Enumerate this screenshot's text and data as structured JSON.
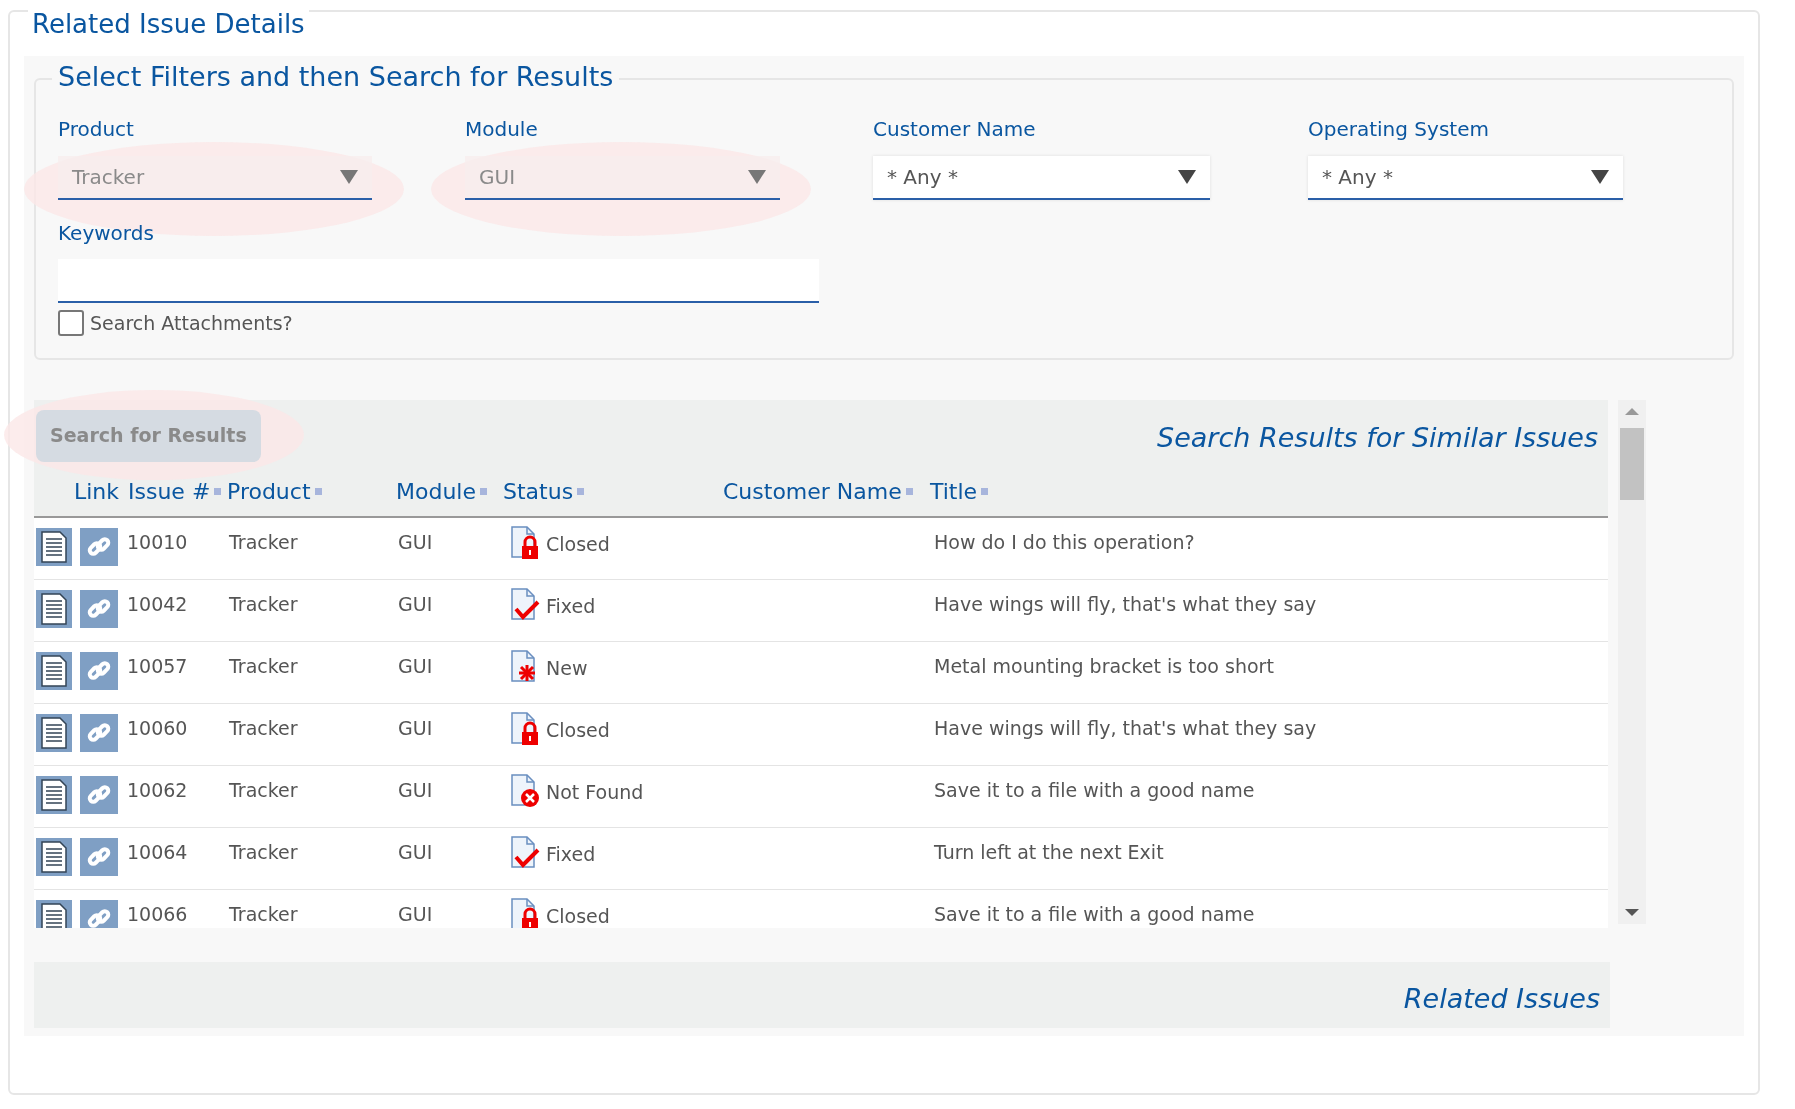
{
  "page_title": "Related Issue Details",
  "filters": {
    "legend": "Select Filters and then Search for Results",
    "selects": [
      {
        "label": "Product",
        "value": "Tracker",
        "disabled": true,
        "highlighted": true
      },
      {
        "label": "Module",
        "value": "GUI",
        "disabled": true,
        "highlighted": true
      },
      {
        "label": "Customer Name",
        "value": "* Any *",
        "disabled": false,
        "highlighted": false
      },
      {
        "label": "Operating System",
        "value": "* Any *",
        "disabled": false,
        "highlighted": false
      }
    ],
    "keywords": {
      "label": "Keywords"
    },
    "search_attachments": {
      "label": "Search Attachments?",
      "checked": false
    }
  },
  "results": {
    "search_button": {
      "label": "Search for Results",
      "disabled": true,
      "highlighted": true
    },
    "title": "Search Results for Similar Issues",
    "columns": [
      {
        "label": "Link",
        "sortable": false
      },
      {
        "label": "Issue #",
        "sortable": true
      },
      {
        "label": "Product",
        "sortable": true
      },
      {
        "label": "Module",
        "sortable": true
      },
      {
        "label": "Status",
        "sortable": true
      },
      {
        "label": "Customer Name",
        "sortable": true
      },
      {
        "label": "Title",
        "sortable": true
      }
    ],
    "rows": [
      {
        "issue": "10010",
        "product": "Tracker",
        "module": "GUI",
        "status": "Closed",
        "kind": "closed",
        "title": "How do I do this operation?"
      },
      {
        "issue": "10042",
        "product": "Tracker",
        "module": "GUI",
        "status": "Fixed",
        "kind": "fixed",
        "title": "Have wings will fly, that's what they say"
      },
      {
        "issue": "10057",
        "product": "Tracker",
        "module": "GUI",
        "status": "New",
        "kind": "new",
        "title": "Metal mounting bracket is too short"
      },
      {
        "issue": "10060",
        "product": "Tracker",
        "module": "GUI",
        "status": "Closed",
        "kind": "closed",
        "title": "Have wings will fly, that's what they say"
      },
      {
        "issue": "10062",
        "product": "Tracker",
        "module": "GUI",
        "status": "Not Found",
        "kind": "not_found",
        "title": "Save it to a file with a good name"
      },
      {
        "issue": "10064",
        "product": "Tracker",
        "module": "GUI",
        "status": "Fixed",
        "kind": "fixed",
        "title": "Turn left at the next Exit"
      },
      {
        "issue": "10066",
        "product": "Tracker",
        "module": "GUI",
        "status": "Closed",
        "kind": "closed",
        "title": "Save it to a file with a good name"
      }
    ]
  },
  "related": {
    "title": "Related Issues"
  }
}
